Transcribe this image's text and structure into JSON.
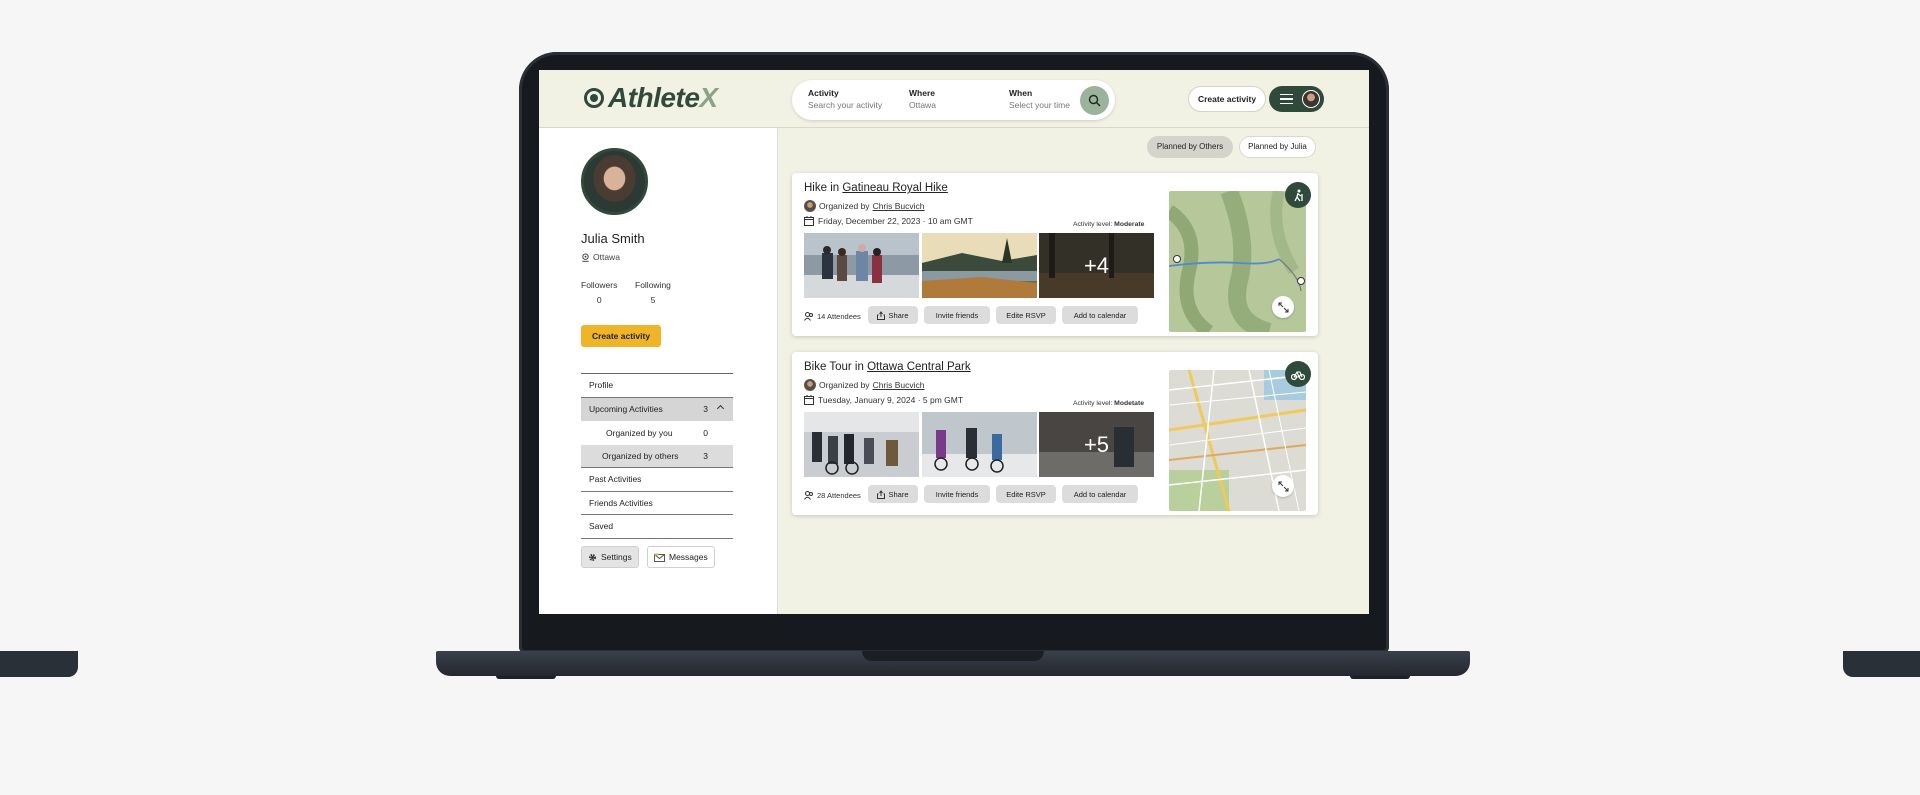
{
  "app": {
    "logo_main": "Athlete",
    "logo_accent": "X"
  },
  "search": {
    "activity_label": "Activity",
    "activity_placeholder": "Search your activity",
    "where_label": "Where",
    "where_value": "Ottawa",
    "when_label": "When",
    "when_placeholder": "Select your time"
  },
  "header": {
    "create_label": "Create activity"
  },
  "profile": {
    "name": "Julia Smith",
    "location": "Ottawa",
    "followers_label": "Followers",
    "followers": "0",
    "following_label": "Following",
    "following": "5",
    "create_label": "Create activity"
  },
  "nav": {
    "profile": "Profile",
    "upcoming": "Upcoming Activities",
    "upcoming_count": "3",
    "by_you": "Organized by you",
    "by_you_count": "0",
    "by_others": "Organized by others",
    "by_others_count": "3",
    "past": "Past Activities",
    "friends": "Friends Activities",
    "saved": "Saved",
    "settings": "Settings",
    "messages": "Messages"
  },
  "filters": {
    "planned_by_others": "Planned by Others",
    "planned_by_julia": "Planned by Julia"
  },
  "cards": [
    {
      "prefix": "Hike in ",
      "place": "Gatineau Royal Hike",
      "organized_by": "Organized by",
      "organizer": "Chris Bucvich",
      "date": "Friday, December 22, 2023  ·  10 am GMT",
      "level_label": "Activity level:",
      "level": "Moderate",
      "more_photos": "+4",
      "attendees": "14 Attendees",
      "type_icon": "hiking-icon"
    },
    {
      "prefix": "Bike Tour in ",
      "place": "Ottawa Central Park",
      "organized_by": "Organized by",
      "organizer": "Chris Bucvich",
      "date": "Tuesday, January 9, 2024  ·  5 pm GMT",
      "level_label": "Activity level:",
      "level": "Modetate",
      "more_photos": "+5",
      "attendees": "28 Attendees",
      "type_icon": "bike-icon"
    }
  ],
  "actions": {
    "share": "Share",
    "invite": "Invite friends",
    "edit_rsvp": "Edite RSVP",
    "calendar": "Add to calendar"
  },
  "colors": {
    "brand": "#2f4a3b",
    "accent": "#f0b428",
    "background": "#f1f1e4"
  }
}
